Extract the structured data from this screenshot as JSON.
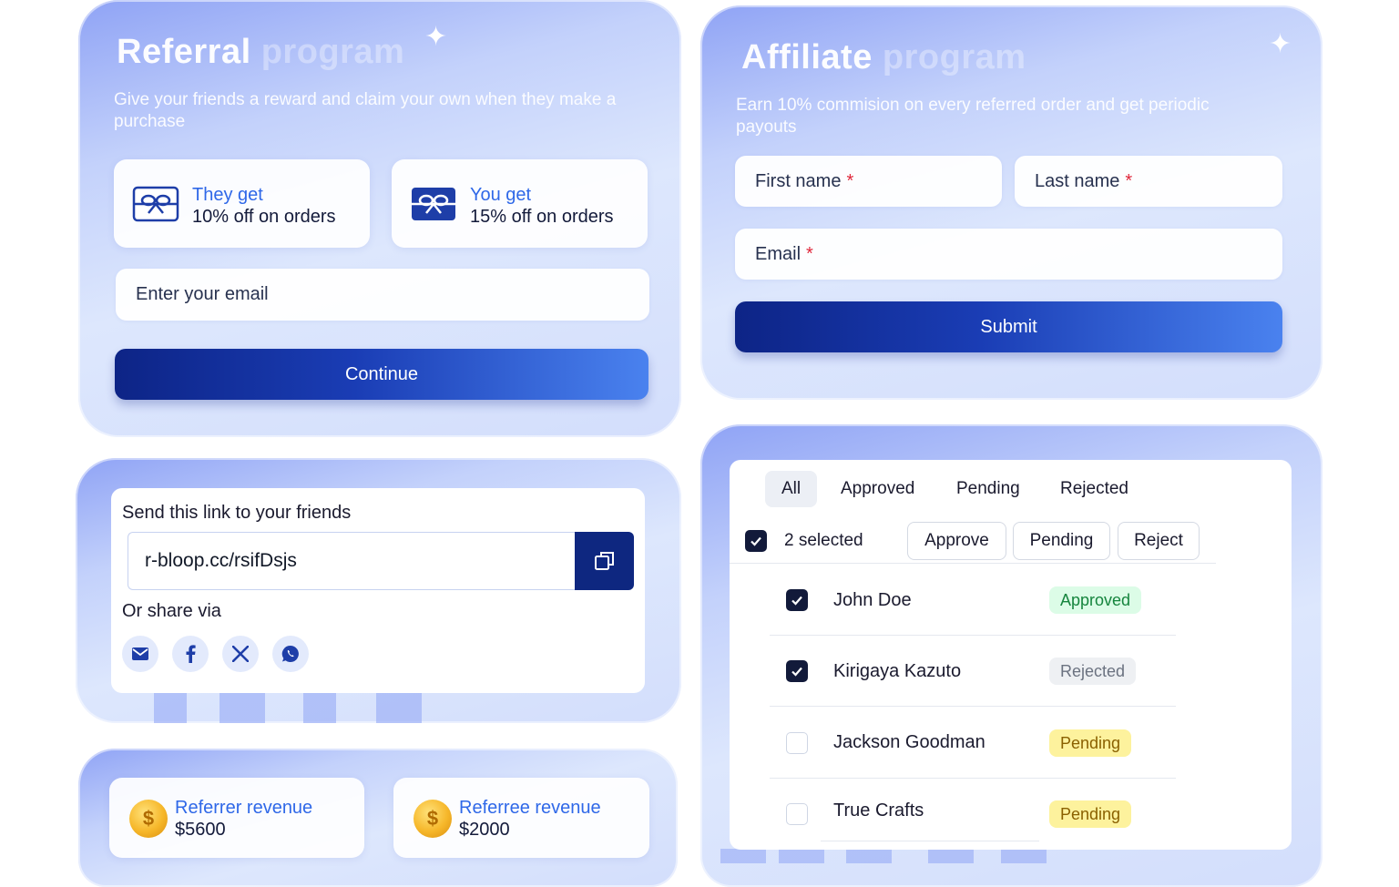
{
  "referral": {
    "title_main": "Referral",
    "title_faded": "program",
    "subtitle": "Give your friends a reward and claim your own when they make a purchase",
    "they_label": "They get",
    "they_value": "10% off on orders",
    "you_label": "You get",
    "you_value": "15% off on orders",
    "email_placeholder": "Enter your email",
    "continue_label": "Continue"
  },
  "affiliate": {
    "title_main": "Affiliate",
    "title_faded": "program",
    "subtitle": "Earn 10% commision on every referred order and get periodic payouts",
    "first_name": "First name",
    "last_name": "Last name",
    "email": "Email",
    "required_mark": "*",
    "submit_label": "Submit"
  },
  "share": {
    "title": "Send this link to your friends",
    "link": "r-bloop.cc/rsifDsjs",
    "share_via": "Or share via",
    "channels": [
      "mail-icon",
      "facebook-icon",
      "x-icon",
      "whatsapp-icon"
    ]
  },
  "revenue": {
    "referrer_label": "Referrer revenue",
    "referrer_value": "$5600",
    "referee_label": "Referree revenue",
    "referee_value": "$2000"
  },
  "requests": {
    "tabs": [
      "All",
      "Approved",
      "Pending",
      "Rejected"
    ],
    "active_tab": "All",
    "selected_text": "2 selected",
    "actions": [
      "Approve",
      "Pending",
      "Reject"
    ],
    "rows": [
      {
        "name": "John Doe",
        "status": "Approved",
        "checked": true
      },
      {
        "name": "Kirigaya Kazuto",
        "status": "Rejected",
        "checked": true
      },
      {
        "name": "Jackson Goodman",
        "status": "Pending",
        "checked": false
      },
      {
        "name": "True Crafts",
        "status": "Pending",
        "checked": false
      }
    ]
  },
  "colors": {
    "accent_blue": "#2f68e8",
    "navy": "#0e2780",
    "approved_bg": "#dcfce7",
    "pending_bg": "#fdf29d",
    "rejected_bg": "#eef0f3"
  }
}
